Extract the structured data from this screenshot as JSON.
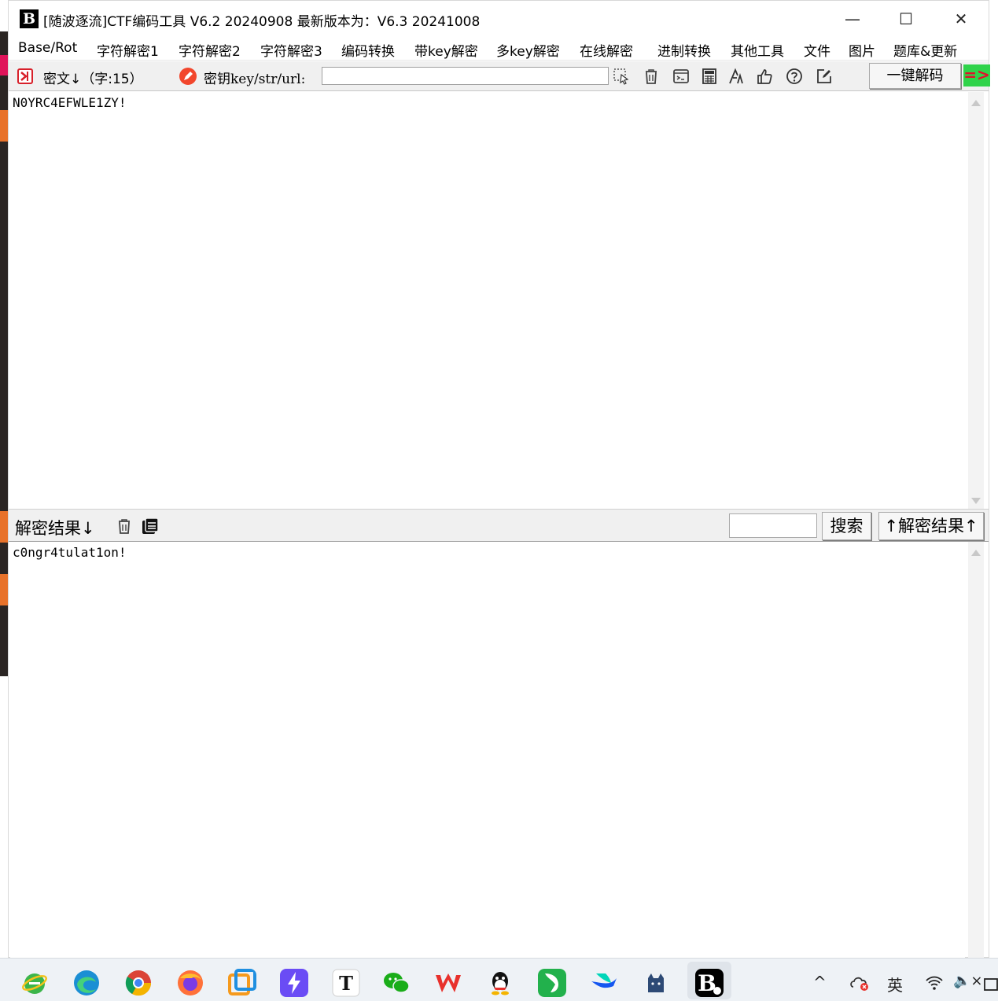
{
  "window": {
    "title": "[随波逐流]CTF编码工具 V6.2 20240908     最新版本为：V6.3 20241008",
    "minimize_glyph": "—",
    "maximize_glyph": "☐",
    "close_glyph": "✕"
  },
  "menu": [
    "Base/Rot",
    "字符解密1",
    "字符解密2",
    "字符解密3",
    "编码转换",
    "带key解密",
    "多key解密",
    "在线解密",
    "进制转换",
    "其他工具",
    "文件",
    "图片",
    "题库&更新"
  ],
  "toolbar": {
    "cipher_label": "密文↓（字:15）",
    "key_label": "密钥key/str/url:",
    "key_value": "",
    "decode_button": "一键解码",
    "go_arrow": "=>",
    "icons": [
      "cursor-select-icon",
      "trash-icon",
      "terminal-icon",
      "calculator-icon",
      "font-icon",
      "thumbs-up-icon",
      "help-icon",
      "edit-icon"
    ]
  },
  "input_text": "N0YRC4EFWLE1ZY!",
  "result_bar": {
    "label": "解密结果↓",
    "search_value": "",
    "search_button": "搜索",
    "swap_button": "↑解密结果↑"
  },
  "output_text": "c0ngr4tulat1on!",
  "taskbar": {
    "apps": [
      "ie-icon",
      "edge-icon",
      "chrome-icon",
      "firefox-icon",
      "vm-icon",
      "bolt-app-icon",
      "typora-icon",
      "wechat-icon",
      "wps-icon",
      "qq-icon",
      "tool-icon",
      "feishu-icon",
      "cat-icon",
      "ctf-tool-icon"
    ],
    "tray_chevron": "^",
    "ime": "英",
    "volume": "🔈×"
  }
}
